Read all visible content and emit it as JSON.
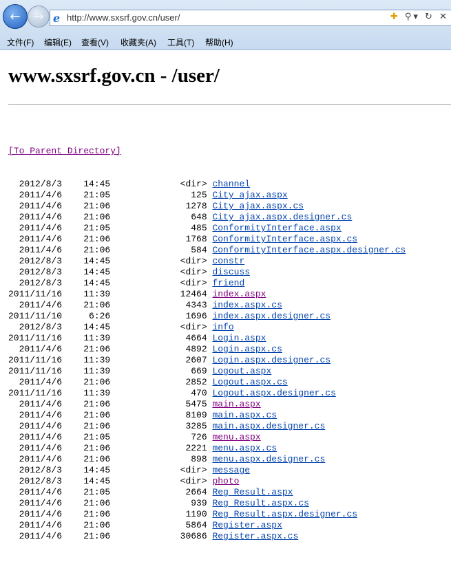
{
  "browser": {
    "url": "http://www.sxsrf.gov.cn/user/",
    "menus": [
      "文件(F)",
      "编辑(E)",
      "查看(V)",
      "收藏夹(A)",
      "工具(T)",
      "帮助(H)"
    ],
    "back_glyph": "←",
    "forward_glyph": "→",
    "ie_glyph": "e",
    "compat_glyph": "✚",
    "search_glyph": "⚲▾",
    "refresh_glyph": "↻",
    "stop_glyph": "✕"
  },
  "page": {
    "title": "www.sxsrf.gov.cn - /user/",
    "parent_link": "[To Parent Directory]"
  },
  "entries": [
    {
      "date": "2012/8/3",
      "time": "14:45",
      "size": "<dir>",
      "name": "channel",
      "visited": false
    },
    {
      "date": "2011/4/6",
      "time": "21:05",
      "size": "125",
      "name": "City_ajax.aspx",
      "visited": false
    },
    {
      "date": "2011/4/6",
      "time": "21:06",
      "size": "1278",
      "name": "City_ajax.aspx.cs",
      "visited": false
    },
    {
      "date": "2011/4/6",
      "time": "21:06",
      "size": "648",
      "name": "City_ajax.aspx.designer.cs",
      "visited": false
    },
    {
      "date": "2011/4/6",
      "time": "21:05",
      "size": "485",
      "name": "ConformityInterface.aspx",
      "visited": false
    },
    {
      "date": "2011/4/6",
      "time": "21:06",
      "size": "1768",
      "name": "ConformityInterface.aspx.cs",
      "visited": false
    },
    {
      "date": "2011/4/6",
      "time": "21:06",
      "size": "584",
      "name": "ConformityInterface.aspx.designer.cs",
      "visited": false
    },
    {
      "date": "2012/8/3",
      "time": "14:45",
      "size": "<dir>",
      "name": "constr",
      "visited": false
    },
    {
      "date": "2012/8/3",
      "time": "14:45",
      "size": "<dir>",
      "name": "discuss",
      "visited": false
    },
    {
      "date": "2012/8/3",
      "time": "14:45",
      "size": "<dir>",
      "name": "friend",
      "visited": false
    },
    {
      "date": "2011/11/16",
      "time": "11:39",
      "size": "12464",
      "name": "index.aspx",
      "visited": true
    },
    {
      "date": "2011/4/6",
      "time": "21:06",
      "size": "4343",
      "name": "index.aspx.cs",
      "visited": false
    },
    {
      "date": "2011/11/10",
      "time": "6:26",
      "size": "1696",
      "name": "index.aspx.designer.cs",
      "visited": false
    },
    {
      "date": "2012/8/3",
      "time": "14:45",
      "size": "<dir>",
      "name": "info",
      "visited": false
    },
    {
      "date": "2011/11/16",
      "time": "11:39",
      "size": "4664",
      "name": "Login.aspx",
      "visited": false
    },
    {
      "date": "2011/4/6",
      "time": "21:06",
      "size": "4892",
      "name": "Login.aspx.cs",
      "visited": false
    },
    {
      "date": "2011/11/16",
      "time": "11:39",
      "size": "2607",
      "name": "Login.aspx.designer.cs",
      "visited": false
    },
    {
      "date": "2011/11/16",
      "time": "11:39",
      "size": "669",
      "name": "Logout.aspx",
      "visited": false
    },
    {
      "date": "2011/4/6",
      "time": "21:06",
      "size": "2852",
      "name": "Logout.aspx.cs",
      "visited": false
    },
    {
      "date": "2011/11/16",
      "time": "11:39",
      "size": "470",
      "name": "Logout.aspx.designer.cs",
      "visited": false
    },
    {
      "date": "2011/4/6",
      "time": "21:06",
      "size": "5475",
      "name": "main.aspx",
      "visited": true
    },
    {
      "date": "2011/4/6",
      "time": "21:06",
      "size": "8109",
      "name": "main.aspx.cs",
      "visited": false
    },
    {
      "date": "2011/4/6",
      "time": "21:06",
      "size": "3285",
      "name": "main.aspx.designer.cs",
      "visited": false
    },
    {
      "date": "2011/4/6",
      "time": "21:05",
      "size": "726",
      "name": "menu.aspx",
      "visited": true
    },
    {
      "date": "2011/4/6",
      "time": "21:06",
      "size": "2221",
      "name": "menu.aspx.cs",
      "visited": false
    },
    {
      "date": "2011/4/6",
      "time": "21:06",
      "size": "898",
      "name": "menu.aspx.designer.cs",
      "visited": false
    },
    {
      "date": "2012/8/3",
      "time": "14:45",
      "size": "<dir>",
      "name": "message",
      "visited": false
    },
    {
      "date": "2012/8/3",
      "time": "14:45",
      "size": "<dir>",
      "name": "photo",
      "visited": true
    },
    {
      "date": "2011/4/6",
      "time": "21:05",
      "size": "2664",
      "name": "Reg_Result.aspx",
      "visited": false
    },
    {
      "date": "2011/4/6",
      "time": "21:06",
      "size": "939",
      "name": "Reg_Result.aspx.cs",
      "visited": false
    },
    {
      "date": "2011/4/6",
      "time": "21:06",
      "size": "1190",
      "name": "Reg_Result.aspx.designer.cs",
      "visited": false
    },
    {
      "date": "2011/4/6",
      "time": "21:06",
      "size": "5864",
      "name": "Register.aspx",
      "visited": false
    },
    {
      "date": "2011/4/6",
      "time": "21:06",
      "size": "30686",
      "name": "Register.aspx.cs",
      "visited": false
    }
  ]
}
